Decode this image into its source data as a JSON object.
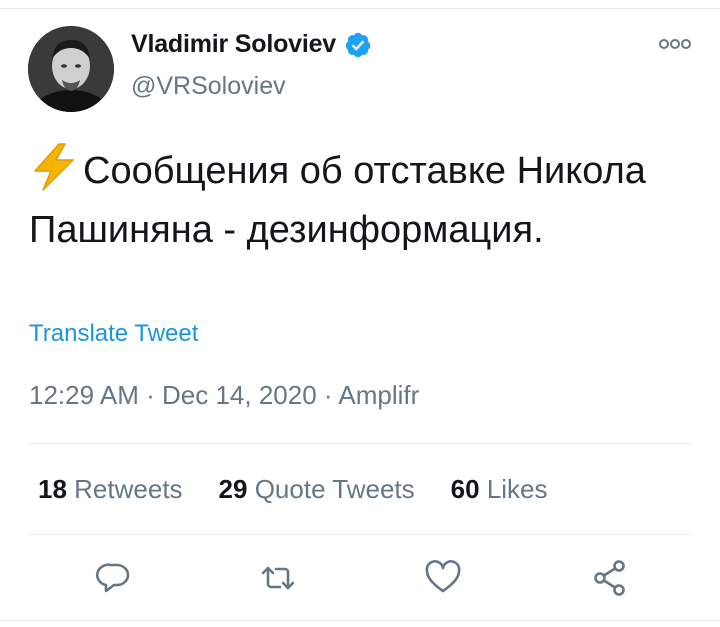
{
  "author": {
    "display_name": "Vladimir Soloviev",
    "handle": "@VRSoloviev",
    "verified": true,
    "avatar_icon": "profile-photo"
  },
  "tweet": {
    "emoji_icon": "high-voltage-icon",
    "text": "Сообщения об отставке Никола Пашиняна - дезинформация.",
    "translate_label": "Translate Tweet",
    "time": "12:29 AM",
    "date": "Dec 14, 2020",
    "source": "Amplifr",
    "separator": "·"
  },
  "stats": {
    "retweets_count": "18",
    "retweets_label": "Retweets",
    "quote_count": "29",
    "quote_label": "Quote Tweets",
    "likes_count": "60",
    "likes_label": "Likes"
  },
  "actions": [
    "reply-icon",
    "retweet-icon",
    "like-icon",
    "share-icon"
  ],
  "colors": {
    "text": "#14171a",
    "secondary": "#657786",
    "link": "#1b95e0",
    "verified": "#1da1f2",
    "divider": "#e6ecf0"
  }
}
